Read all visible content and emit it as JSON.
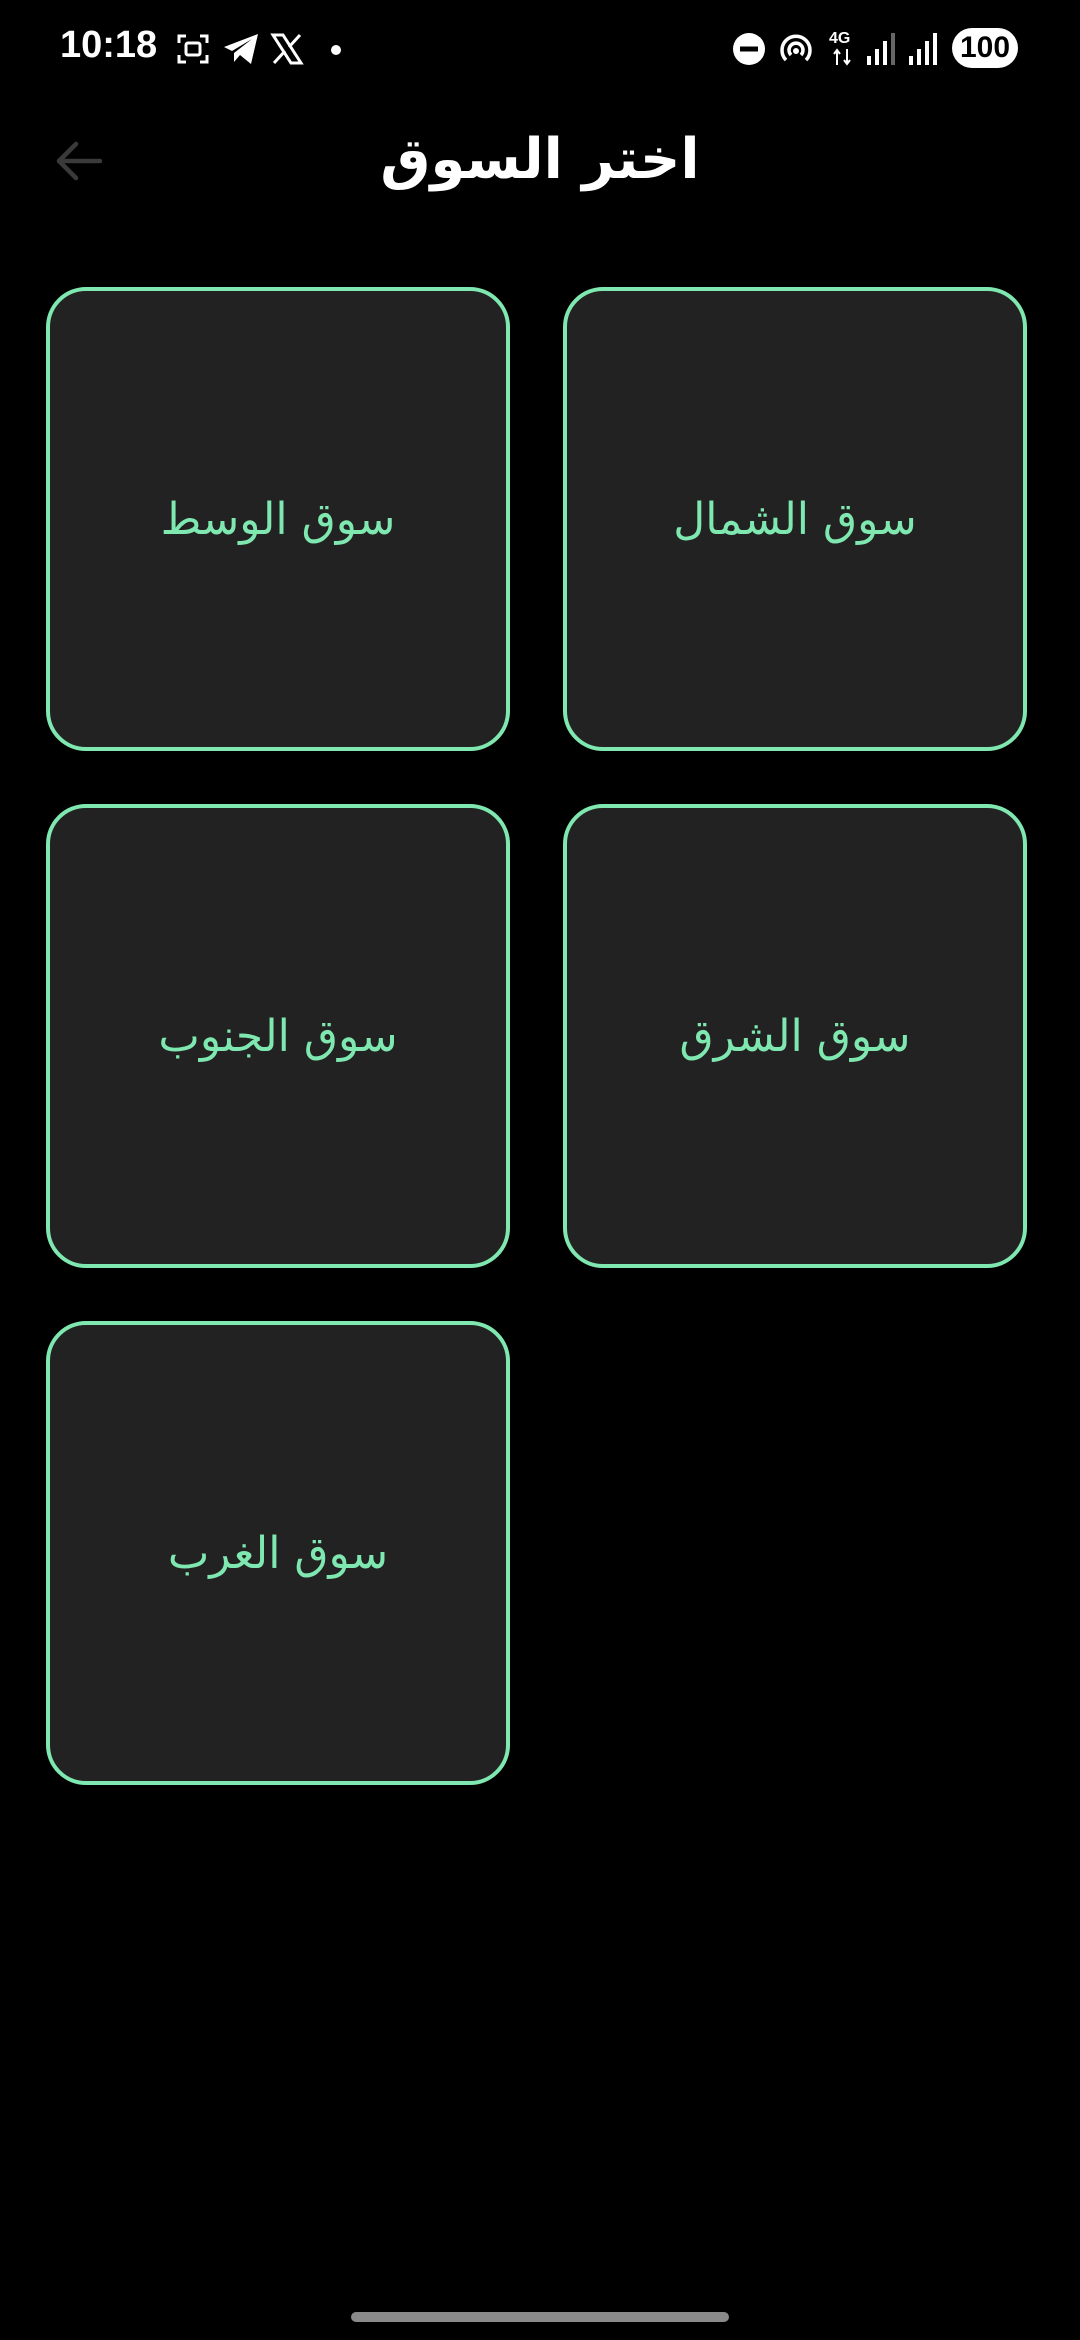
{
  "status_bar": {
    "time": "10:18",
    "network": "4G",
    "battery": "100"
  },
  "header": {
    "back_icon": "arrow-left-icon",
    "title": "اختر السوق"
  },
  "markets": [
    {
      "label": "سوق الشمال"
    },
    {
      "label": "سوق الوسط"
    },
    {
      "label": "سوق الشرق"
    },
    {
      "label": "سوق الجنوب"
    },
    {
      "label": "سوق الغرب"
    }
  ],
  "colors": {
    "background": "#000000",
    "card_background": "#222222",
    "accent": "#7fe7b0"
  }
}
